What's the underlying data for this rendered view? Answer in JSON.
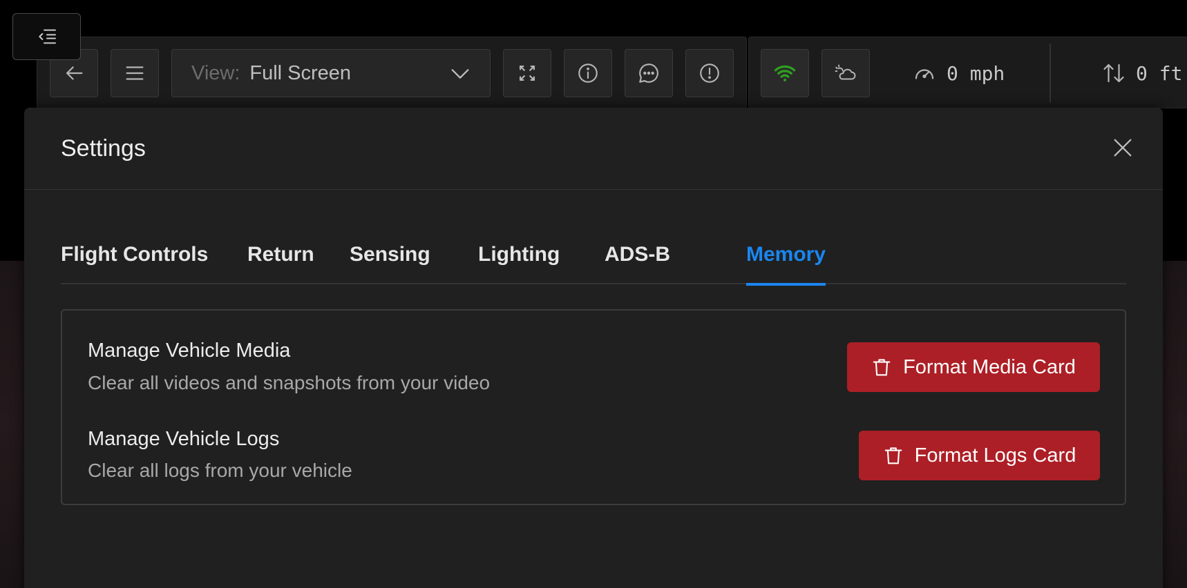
{
  "toolbar": {
    "view_label": "View:",
    "view_value": "Full Screen",
    "speed": "0 mph",
    "altitude": "0 ft",
    "icons": [
      "collapse-sidebar-icon",
      "back-arrow-icon",
      "menu-icon",
      "chevron-down-icon",
      "fullscreen-icon",
      "info-icon",
      "chat-icon",
      "alert-icon",
      "wifi-icon",
      "weather-icon",
      "speedometer-icon",
      "altitude-arrows-icon"
    ],
    "wifi_color": "#2e9e1f"
  },
  "modal": {
    "title": "Settings",
    "tabs": [
      {
        "label": "Flight Controls"
      },
      {
        "label": "Return"
      },
      {
        "label": "Sensing"
      },
      {
        "label": "Lighting"
      },
      {
        "label": "ADS-B"
      },
      {
        "label": "Memory"
      }
    ],
    "active_tab": "Memory",
    "rows": [
      {
        "title": "Manage Vehicle Media",
        "description": "Clear all videos and snapshots from your video",
        "button_label": "Format Media Card"
      },
      {
        "title": "Manage Vehicle Logs",
        "description": "Clear all logs from your vehicle",
        "button_label": "Format Logs Card"
      }
    ]
  },
  "colors": {
    "accent": "#1a86f0",
    "danger": "#ad1f26",
    "panel": "#202020"
  }
}
